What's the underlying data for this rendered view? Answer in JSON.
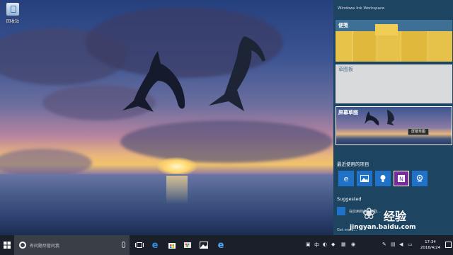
{
  "desktop": {
    "icon_label": "回收站"
  },
  "ink_workspace": {
    "title": "Windows Ink Workspace",
    "sticky_notes_label": "便笺",
    "sketchpad_label": "草图板",
    "screen_sketch_label": "屏幕草图",
    "screen_sketch_tooltip": "屏幕草图",
    "recent_heading": "最近使用的项目",
    "recent_apps": [
      {
        "icon": "edge-icon",
        "color": "#1f72c7"
      },
      {
        "icon": "photos-icon",
        "color": "#1f72c7"
      },
      {
        "icon": "tips-icon",
        "color": "#1f72c7"
      },
      {
        "icon": "onenote-icon",
        "color": "#7a2b9b"
      },
      {
        "icon": "maps-icon",
        "color": "#1f72c7"
      }
    ],
    "suggested_heading": "Suggested",
    "suggested_item": "在应用商店中获取...",
    "suggested_more": "Get more..."
  },
  "taskbar": {
    "search_placeholder": "有问题尽管问我",
    "clock_time": "17:34",
    "clock_date": "2016/4/24",
    "input_indicator": "中"
  },
  "watermark": {
    "brand": "经验",
    "url": "jingyan.baidu.com"
  },
  "colors": {
    "panel_bg": "#1d4460",
    "taskbar_bg": "#1a1f2a",
    "accent": "#1f72c7",
    "sticky_yellow": "#e8c34a"
  }
}
